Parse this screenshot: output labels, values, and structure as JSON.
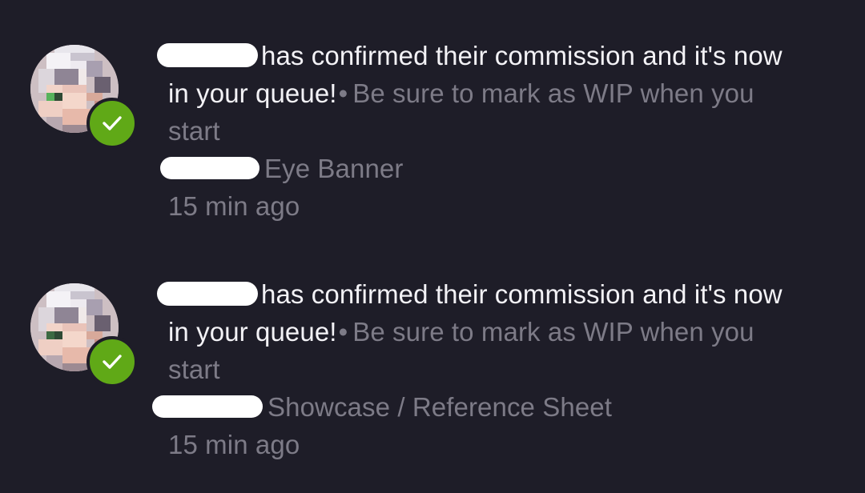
{
  "notifications": [
    {
      "message": "has confirmed their commission and it's now in your queue!",
      "separator": "•",
      "hint": "Be sure to mark as WIP when you start",
      "commission": "Eye Banner",
      "time": "15 min ago",
      "avatar_icon": "pixelated-avatar",
      "badge_icon": "checkmark-icon",
      "badge_color": "#60a917"
    },
    {
      "message": "has confirmed their commission and it's now in your queue!",
      "separator": "•",
      "hint": "Be sure to mark as WIP when you start",
      "commission": "Showcase / Reference Sheet",
      "time": "15 min ago",
      "avatar_icon": "pixelated-avatar",
      "badge_icon": "checkmark-icon",
      "badge_color": "#60a917"
    }
  ],
  "colors": {
    "background": "#1e1d28",
    "primary_text": "#f3f2f6",
    "secondary_text": "#7d7b87",
    "redaction": "#ffffff"
  }
}
